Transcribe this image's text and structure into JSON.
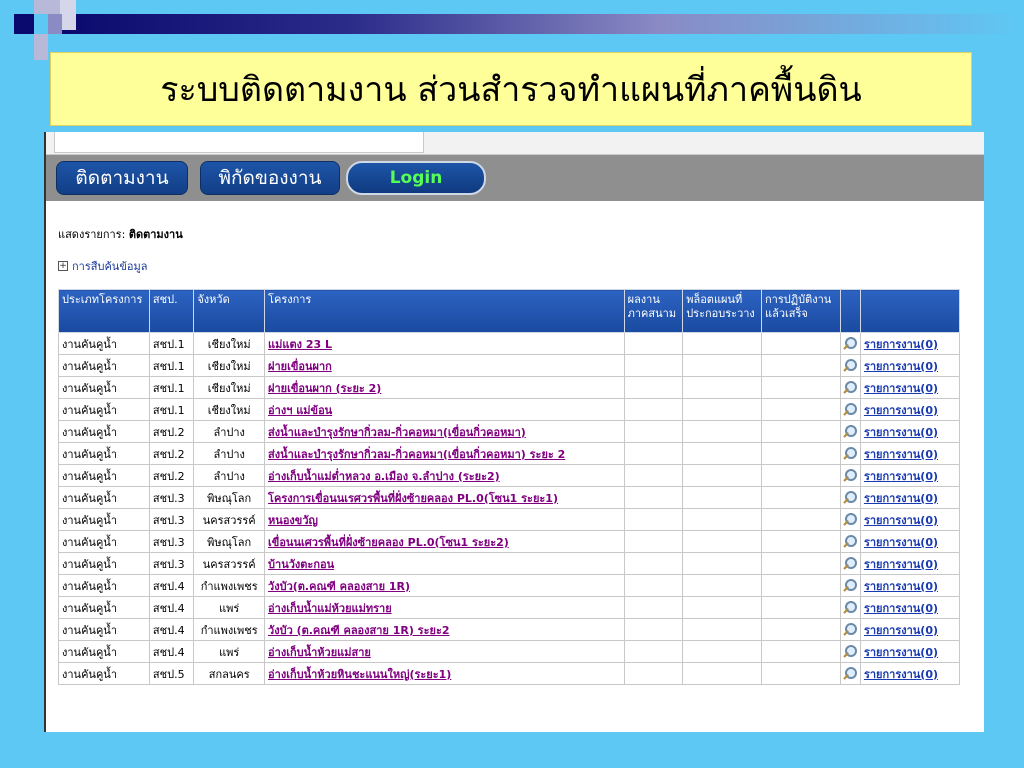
{
  "slide": {
    "title": "ระบบติดตามงาน ส่วนสำรวจทำแผนที่ภาคพื้นดิน"
  },
  "nav": {
    "tab1": "ติดตามงาน",
    "tab2": "พิกัดของงาน",
    "login": "Login"
  },
  "breadcrumb": {
    "label": "แสดงรายการ:",
    "value": "ติดตามงาน"
  },
  "search": {
    "label": "การสืบค้นข้อมูล"
  },
  "table": {
    "headers": [
      "ประเภทโครงการ",
      "สชป.",
      "จังหวัด",
      "โครงการ",
      "ผลงาน ภาคสนาม",
      "พล็อตแผนที่ ประกอบระวาง",
      "การปฏิบัติงาน แล้วเสร็จ",
      "",
      ""
    ],
    "rows": [
      {
        "type": "งานคันคูน้ำ",
        "office": "สชป.1",
        "province": "เชียงใหม่",
        "project": "แม่แตง 23 L",
        "report": "รายการงาน(0)"
      },
      {
        "type": "งานคันคูน้ำ",
        "office": "สชป.1",
        "province": "เชียงใหม่",
        "project": "ฝายเขื่อนผาก",
        "report": "รายการงาน(0)"
      },
      {
        "type": "งานคันคูน้ำ",
        "office": "สชป.1",
        "province": "เชียงใหม่",
        "project": "ฝายเขื่อนผาก (ระยะ 2)",
        "report": "รายการงาน(0)"
      },
      {
        "type": "งานคันคูน้ำ",
        "office": "สชป.1",
        "province": "เชียงใหม่",
        "project": "อ่างฯ แม่ข้อน",
        "report": "รายการงาน(0)"
      },
      {
        "type": "งานคันคูน้ำ",
        "office": "สชป.2",
        "province": "ลำปาง",
        "project": "ส่งน้ำและบำรุงรักษากิ่วลม-กิ่วคอหมา(เขื่อนกิ่วคอหมา)",
        "report": "รายการงาน(0)"
      },
      {
        "type": "งานคันคูน้ำ",
        "office": "สชป.2",
        "province": "ลำปาง",
        "project": "ส่งน้ำและบำรุงรักษากิ่วลม-กิ่วคอหมา(เขื่อนกิ่วคอหมา) ระยะ 2",
        "report": "รายการงาน(0)"
      },
      {
        "type": "งานคันคูน้ำ",
        "office": "สชป.2",
        "province": "ลำปาง",
        "project": "อ่างเก็บน้ำแม่ต่ำหลวง อ.เมือง จ.ลำปาง (ระยะ2)",
        "report": "รายการงาน(0)"
      },
      {
        "type": "งานคันคูน้ำ",
        "office": "สชป.3",
        "province": "พิษณุโลก",
        "project": "โครงการเขื่อนนเรศวรพื้นที่ฝั่งซ้ายคลอง PL.0(โซน1 ระยะ1)",
        "report": "รายการงาน(0)"
      },
      {
        "type": "งานคันคูน้ำ",
        "office": "สชป.3",
        "province": "นครสวรรค์",
        "project": "หนองขวัญ",
        "report": "รายการงาน(0)"
      },
      {
        "type": "งานคันคูน้ำ",
        "office": "สชป.3",
        "province": "พิษณุโลก",
        "project": "เขื่อนนเศวรพื้นที่ฝั่งซ้ายคลอง PL.0(โซน1 ระยะ2)",
        "report": "รายการงาน(0)"
      },
      {
        "type": "งานคันคูน้ำ",
        "office": "สชป.3",
        "province": "นครสวรรค์",
        "project": "บ้านวังตะกอน",
        "report": "รายการงาน(0)"
      },
      {
        "type": "งานคันคูน้ำ",
        "office": "สชป.4",
        "province": "กำแพงเพชร",
        "project": "วังบัว(ต.คณฑี คลองสาย 1R)",
        "report": "รายการงาน(0)"
      },
      {
        "type": "งานคันคูน้ำ",
        "office": "สชป.4",
        "province": "แพร่",
        "project": "อ่างเก็บน้ำแม่ห้วยแม่ทราย",
        "report": "รายการงาน(0)"
      },
      {
        "type": "งานคันคูน้ำ",
        "office": "สชป.4",
        "province": "กำแพงเพชร",
        "project": "วังบัว (ต.คณฑี คลองสาย 1R) ระยะ2",
        "report": "รายการงาน(0)"
      },
      {
        "type": "งานคันคูน้ำ",
        "office": "สชป.4",
        "province": "แพร่",
        "project": "อ่างเก็บน้ำห้วยแม่สาย",
        "report": "รายการงาน(0)"
      },
      {
        "type": "งานคันคูน้ำ",
        "office": "สชป.5",
        "province": "สกลนคร",
        "project": "อ่างเก็บน้ำห้วยหินชะแนนใหญ่(ระยะ1)",
        "report": "รายการงาน(0)"
      }
    ]
  },
  "colors": {
    "slide_bg": "#5ec8f5",
    "title_bg": "#ffff99",
    "header_blue": "#1a4aa0",
    "login_text": "#55ff55",
    "project_link": "#800080"
  },
  "icons": {
    "row_action": "magnifier-icon"
  }
}
